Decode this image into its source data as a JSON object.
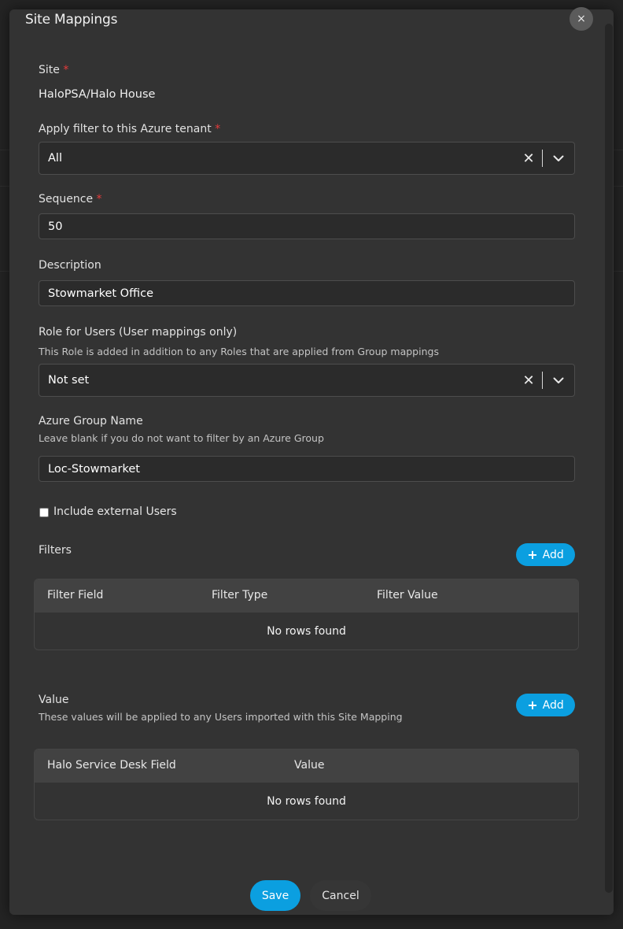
{
  "modal": {
    "title": "Site Mappings",
    "close_glyph": "×"
  },
  "site": {
    "label": "Site",
    "required_mark": "*",
    "value": "HaloPSA/Halo House"
  },
  "tenant": {
    "label": "Apply filter to this Azure tenant",
    "required_mark": "*",
    "value": "All",
    "clear_glyph": "✕"
  },
  "sequence": {
    "label": "Sequence",
    "required_mark": "*",
    "value": "50"
  },
  "description": {
    "label": "Description",
    "value": "Stowmarket Office"
  },
  "role": {
    "label": "Role for Users (User mappings only)",
    "hint": "This Role is added in addition to any Roles that are applied from Group mappings",
    "value": "Not set",
    "clear_glyph": "✕"
  },
  "azure_group": {
    "label": "Azure Group Name",
    "hint": "Leave blank if you do not want to filter by an Azure Group",
    "value": "Loc-Stowmarket"
  },
  "include_external": {
    "label": "Include external Users",
    "checked": false
  },
  "filters": {
    "label": "Filters",
    "add_label": "Add",
    "columns": [
      "Filter Field",
      "Filter Type",
      "Filter Value"
    ],
    "empty_text": "No rows found"
  },
  "values": {
    "label": "Value",
    "hint": "These values will be applied to any Users imported with this Site Mapping",
    "add_label": "Add",
    "columns": [
      "Halo Service Desk Field",
      "Value"
    ],
    "empty_text": "No rows found"
  },
  "footer": {
    "save_label": "Save",
    "cancel_label": "Cancel"
  },
  "colors": {
    "accent": "#0b9fe0",
    "required": "#e53b3b",
    "dialog_bg": "#333333"
  },
  "icons": [
    "close-icon",
    "clear-icon",
    "chevron-down-icon",
    "plus-icon"
  ]
}
